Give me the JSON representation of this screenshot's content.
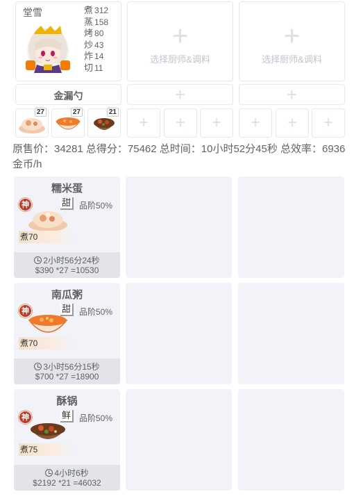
{
  "chef": {
    "name": "堂雪",
    "skills": [
      {
        "label": "煮",
        "value": "312"
      },
      {
        "label": "蒸",
        "value": "158"
      },
      {
        "label": "烤",
        "value": "80"
      },
      {
        "label": "炒",
        "value": "43"
      },
      {
        "label": "炸",
        "value": "14"
      },
      {
        "label": "切",
        "value": "11"
      }
    ]
  },
  "empty_slot_label": "选择厨师&调料",
  "equipment": {
    "name": "金漏勺"
  },
  "recipe_slots": [
    {
      "qty": "27"
    },
    {
      "qty": "27"
    },
    {
      "qty": "21"
    }
  ],
  "summary": "原售价：34281 总得分：75462 总时间：10小时52分45秒 总效率：6936金币/h",
  "recipes": [
    {
      "name": "糯米蛋",
      "rank": "神",
      "flavor": "甜",
      "quality": "品阶50%",
      "skill": "煮70",
      "time": "2小时56分24秒",
      "price": "$390 *27 =10530"
    },
    {
      "name": "南瓜粥",
      "rank": "神",
      "flavor": "甜",
      "quality": "品阶50%",
      "skill": "煮70",
      "time": "3小时56分15秒",
      "price": "$700 *27 =18900"
    },
    {
      "name": "酥锅",
      "rank": "神",
      "flavor": "鲜",
      "quality": "品阶50%",
      "skill": "煮75",
      "time": "4小时6秒",
      "price": "$2192 *21 =46032"
    }
  ],
  "icons": {
    "plus": "+",
    "clock": "clock-icon"
  },
  "colors": {
    "rank_badge": "#c0392b",
    "card_bg": "#f2f3f8",
    "footer_bg": "#e2e4ea"
  }
}
